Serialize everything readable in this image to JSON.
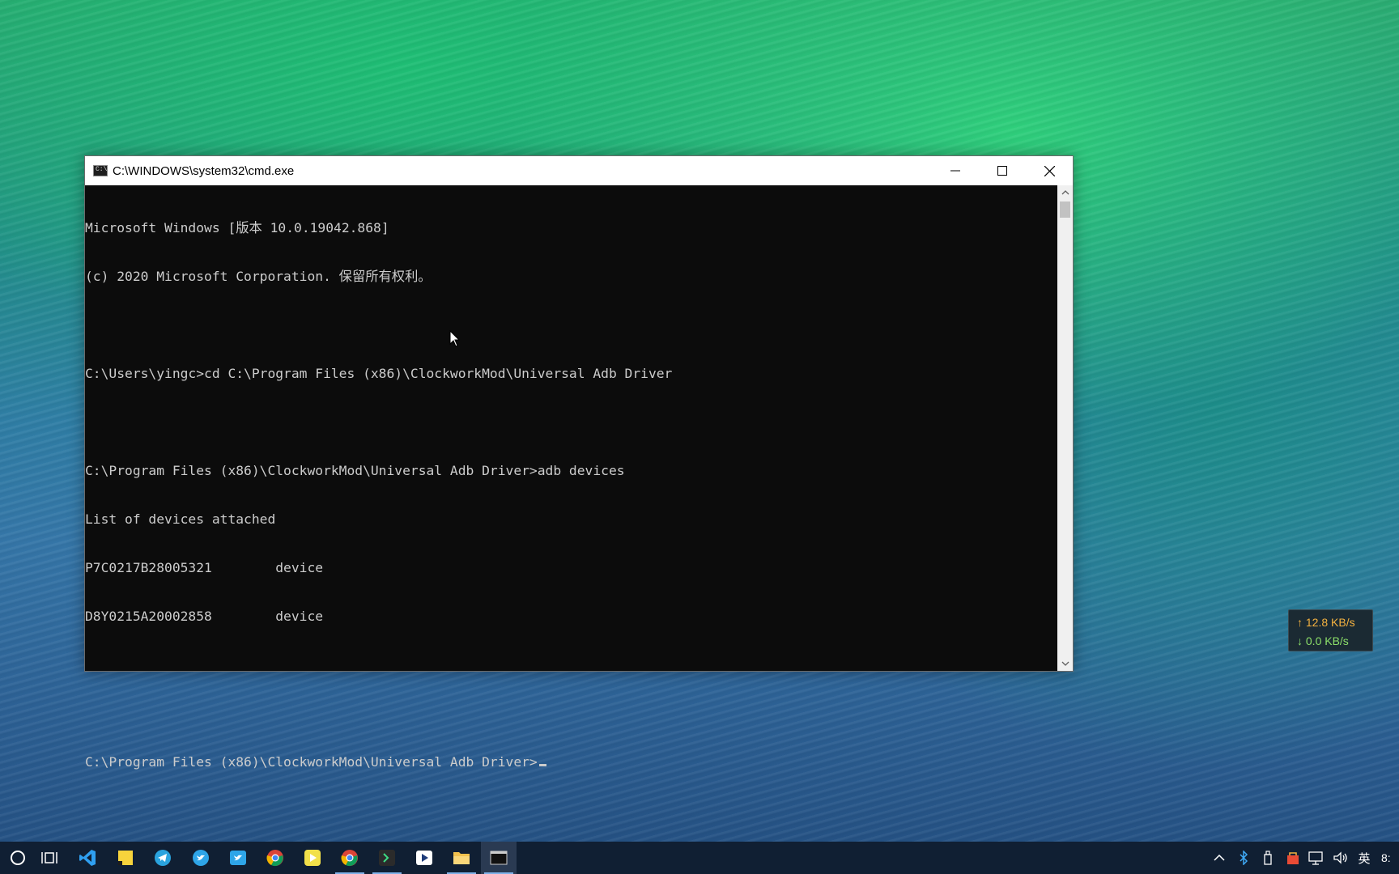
{
  "window": {
    "title": "C:\\WINDOWS\\system32\\cmd.exe",
    "icon_label": "C:\\"
  },
  "console": {
    "lines": [
      "Microsoft Windows [版本 10.0.19042.868]",
      "(c) 2020 Microsoft Corporation. 保留所有权利。",
      "",
      "C:\\Users\\yingc>cd C:\\Program Files (x86)\\ClockworkMod\\Universal Adb Driver",
      "",
      "C:\\Program Files (x86)\\ClockworkMod\\Universal Adb Driver>adb devices",
      "List of devices attached",
      "P7C0217B28005321        device",
      "D8Y0215A20002858        device",
      "",
      "",
      "C:\\Program Files (x86)\\ClockworkMod\\Universal Adb Driver>"
    ]
  },
  "network": {
    "upload": "↑ 12.8 KB/s",
    "download": "↓ 0.0 KB/s"
  },
  "taskbar": {
    "apps": [
      "search-circle-icon",
      "task-view-icon",
      "vscode-icon",
      "sticky-notes-icon",
      "telegram-icon",
      "twitter-icon",
      "twitter-alt-icon",
      "chrome-icon",
      "media-player-icon",
      "chrome-alt-icon",
      "terminal-app-icon",
      "video-app-icon",
      "file-explorer-icon",
      "cmd-icon"
    ],
    "tray_ime": "英",
    "clock_partial": "8:"
  },
  "colors": {
    "console_bg": "#0c0c0c",
    "console_fg": "#cccccc",
    "taskbar_bg": "#101f33",
    "net_up": "#f5b240",
    "net_down": "#8de06a"
  }
}
